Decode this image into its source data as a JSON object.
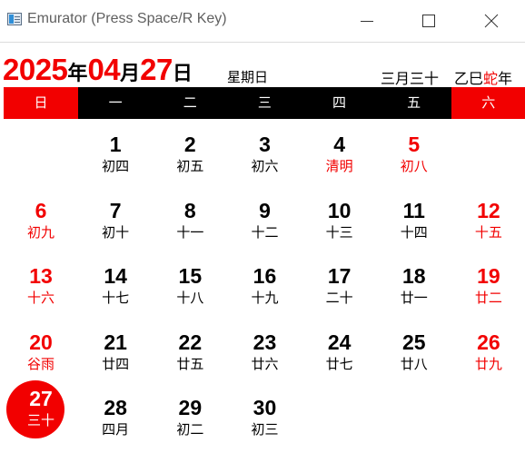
{
  "window": {
    "title": "Emurator (Press Space/R Key)"
  },
  "header": {
    "year": "2025",
    "year_unit": "年",
    "month": "04",
    "month_unit": "月",
    "day": "27",
    "day_unit": "日",
    "weekday": "星期日",
    "lunar_date": "三月三十",
    "ganzhi": "乙巳",
    "zodiac": "蛇",
    "year_suffix": "年"
  },
  "weekdays": [
    "日",
    "一",
    "二",
    "三",
    "四",
    "五",
    "六"
  ],
  "colors": {
    "accent_red": "#f20000",
    "weekday_bar": "#000000",
    "text": "#000000"
  },
  "days": [
    {
      "day": "1",
      "lunar": "初四",
      "col": 1,
      "row": 0
    },
    {
      "day": "2",
      "lunar": "初五",
      "col": 2,
      "row": 0
    },
    {
      "day": "3",
      "lunar": "初六",
      "col": 3,
      "row": 0
    },
    {
      "day": "4",
      "lunar": "清明",
      "col": 4,
      "row": 0,
      "term": true
    },
    {
      "day": "5",
      "lunar": "初八",
      "col": 5,
      "row": 0,
      "weekend": true
    },
    {
      "day": "6",
      "lunar": "初九",
      "col": 0,
      "row": 1,
      "weekend": true
    },
    {
      "day": "7",
      "lunar": "初十",
      "col": 1,
      "row": 1
    },
    {
      "day": "8",
      "lunar": "十一",
      "col": 2,
      "row": 1
    },
    {
      "day": "9",
      "lunar": "十二",
      "col": 3,
      "row": 1
    },
    {
      "day": "10",
      "lunar": "十三",
      "col": 4,
      "row": 1
    },
    {
      "day": "11",
      "lunar": "十四",
      "col": 5,
      "row": 1
    },
    {
      "day": "12",
      "lunar": "十五",
      "col": 6,
      "row": 1,
      "weekend": true
    },
    {
      "day": "13",
      "lunar": "十六",
      "col": 0,
      "row": 2,
      "weekend": true
    },
    {
      "day": "14",
      "lunar": "十七",
      "col": 1,
      "row": 2
    },
    {
      "day": "15",
      "lunar": "十八",
      "col": 2,
      "row": 2
    },
    {
      "day": "16",
      "lunar": "十九",
      "col": 3,
      "row": 2
    },
    {
      "day": "17",
      "lunar": "二十",
      "col": 4,
      "row": 2
    },
    {
      "day": "18",
      "lunar": "廿一",
      "col": 5,
      "row": 2
    },
    {
      "day": "19",
      "lunar": "廿二",
      "col": 6,
      "row": 2,
      "weekend": true
    },
    {
      "day": "20",
      "lunar": "谷雨",
      "col": 0,
      "row": 3,
      "weekend": true
    },
    {
      "day": "21",
      "lunar": "廿四",
      "col": 1,
      "row": 3
    },
    {
      "day": "22",
      "lunar": "廿五",
      "col": 2,
      "row": 3
    },
    {
      "day": "23",
      "lunar": "廿六",
      "col": 3,
      "row": 3
    },
    {
      "day": "24",
      "lunar": "廿七",
      "col": 4,
      "row": 3
    },
    {
      "day": "25",
      "lunar": "廿八",
      "col": 5,
      "row": 3
    },
    {
      "day": "26",
      "lunar": "廿九",
      "col": 6,
      "row": 3,
      "weekend": true
    },
    {
      "day": "27",
      "lunar": "三十",
      "col": 0,
      "row": 4,
      "today": true
    },
    {
      "day": "28",
      "lunar": "四月",
      "col": 1,
      "row": 4
    },
    {
      "day": "29",
      "lunar": "初二",
      "col": 2,
      "row": 4
    },
    {
      "day": "30",
      "lunar": "初三",
      "col": 3,
      "row": 4
    }
  ]
}
